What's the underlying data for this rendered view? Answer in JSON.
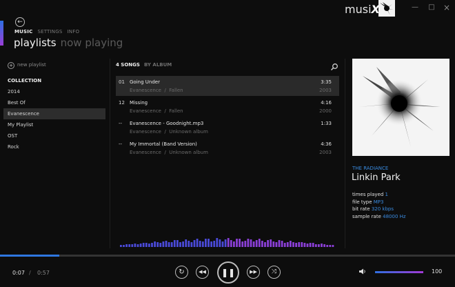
{
  "app": {
    "brand_prefix": "musi",
    "brand_suffix": "X",
    "minimize_glyph": "—",
    "maximize_glyph": "□",
    "close_glyph": "×",
    "accent_color": "#2f77e0",
    "accent_color_2": "#a23ad6"
  },
  "nav": {
    "back_glyph": "←",
    "items": [
      "MUSIC",
      "SETTINGS",
      "INFO"
    ],
    "active_item": "MUSIC",
    "pivots": [
      "playlists",
      "now playing"
    ],
    "active_pivot": "playlists"
  },
  "sidebar": {
    "new_playlist_label": "new playlist",
    "collection_header": "COLLECTION",
    "items": [
      "2014",
      "Best Of",
      "Evanescence",
      "My Playlist",
      "OST",
      "Rock"
    ],
    "selected_item": "Evanescence"
  },
  "songs": {
    "count_label": "4 SONGS",
    "sort_label": "BY ALBUM",
    "list": [
      {
        "num": "01",
        "title": "Going Under",
        "artist": "Evanescence",
        "album": "Fallen",
        "duration": "3:35",
        "year": "2003",
        "selected": true
      },
      {
        "num": "12",
        "title": "Missing",
        "artist": "Evanescence",
        "album": "Fallen",
        "duration": "4:16",
        "year": "2000",
        "selected": false
      },
      {
        "num": "--",
        "title": "Evanescence - Goodnight.mp3",
        "artist": "Evanescence",
        "album": "Unknown album",
        "duration": "1:33",
        "year": "",
        "selected": false
      },
      {
        "num": "--",
        "title": "My Immortal (Band Version)",
        "artist": "Evanescence",
        "album": "Unknown album",
        "duration": "4:36",
        "year": "2003",
        "selected": false
      }
    ],
    "separator": "/"
  },
  "now_playing": {
    "album": "THE RADIANCE",
    "artist": "Linkin Park",
    "meta": [
      {
        "key": "times played",
        "value": "1"
      },
      {
        "key": "file type",
        "value": "MP3"
      },
      {
        "key": "bit rate",
        "value": "320 kbps"
      },
      {
        "key": "sample rate",
        "value": "48000 Hz"
      }
    ]
  },
  "player": {
    "current_time": "0:07",
    "time_separator": "/",
    "total_time": "0:57",
    "progress": 0.13,
    "volume": "100",
    "volume_fraction": 1.0,
    "icons": {
      "repeat": "repeat-icon",
      "prev": "previous-icon",
      "play_pause": "pause-icon",
      "next": "next-icon",
      "shuffle": "shuffle-icon",
      "volume": "speaker-icon"
    },
    "glyphs": {
      "repeat": "↻",
      "prev": "◀◀",
      "pause": "❚❚",
      "next": "▶▶",
      "shuffle": "⤨",
      "volume": "🔈"
    }
  }
}
